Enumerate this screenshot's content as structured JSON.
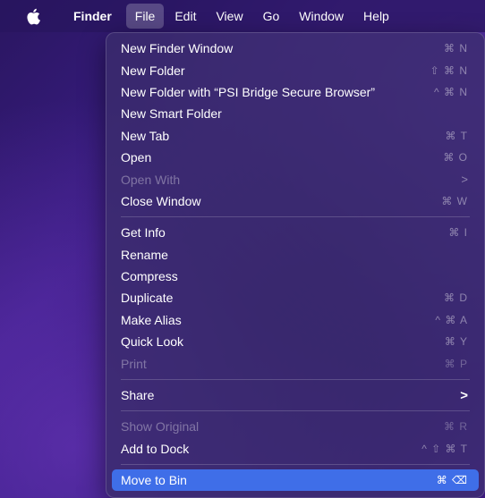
{
  "menubar": {
    "apple_icon": "apple-logo-icon",
    "app_name": "Finder",
    "menus": [
      "File",
      "Edit",
      "View",
      "Go",
      "Window",
      "Help"
    ],
    "active_menu": "File"
  },
  "file_menu": {
    "sections": [
      [
        {
          "label": "New Finder Window",
          "shortcut": "⌘ N",
          "enabled": true
        },
        {
          "label": "New Folder",
          "shortcut": "⇧ ⌘ N",
          "enabled": true
        },
        {
          "label": "New Folder with “PSI Bridge Secure Browser”",
          "shortcut": "^ ⌘ N",
          "enabled": true
        },
        {
          "label": "New Smart Folder",
          "shortcut": "",
          "enabled": true
        },
        {
          "label": "New Tab",
          "shortcut": "⌘ T",
          "enabled": true
        },
        {
          "label": "Open",
          "shortcut": "⌘ O",
          "enabled": true
        },
        {
          "label": "Open With",
          "shortcut": ">",
          "enabled": false
        },
        {
          "label": "Close Window",
          "shortcut": "⌘ W",
          "enabled": true
        }
      ],
      [
        {
          "label": "Get Info",
          "shortcut": "⌘ I",
          "enabled": true
        },
        {
          "label": "Rename",
          "shortcut": "",
          "enabled": true
        },
        {
          "label": "Compress",
          "shortcut": "",
          "enabled": true
        },
        {
          "label": "Duplicate",
          "shortcut": "⌘ D",
          "enabled": true
        },
        {
          "label": "Make Alias",
          "shortcut": "^ ⌘ A",
          "enabled": true
        },
        {
          "label": "Quick Look",
          "shortcut": "⌘ Y",
          "enabled": true
        },
        {
          "label": "Print",
          "shortcut": "⌘ P",
          "enabled": false
        }
      ],
      [
        {
          "label": "Share",
          "shortcut": ">",
          "enabled": true
        }
      ],
      [
        {
          "label": "Show Original",
          "shortcut": "⌘ R",
          "enabled": false
        },
        {
          "label": "Add to Dock",
          "shortcut": "^ ⇧ ⌘ T",
          "enabled": true
        }
      ],
      [
        {
          "label": "Move to Bin",
          "shortcut": "⌘ ⌫",
          "enabled": true,
          "highlighted": true
        }
      ]
    ]
  },
  "colors": {
    "highlight": "#3f6ee8",
    "wallpaper": "#2c1878"
  }
}
